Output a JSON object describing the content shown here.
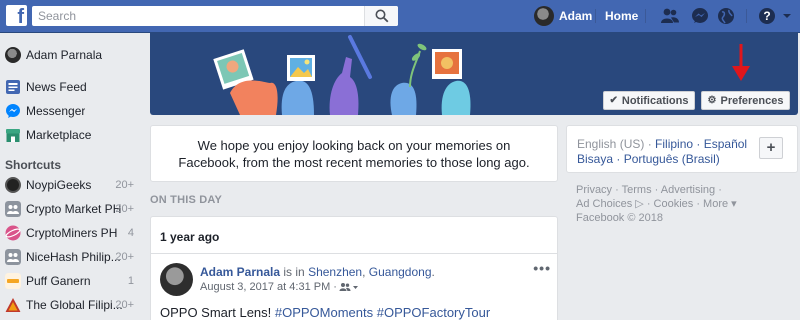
{
  "topbar": {
    "search_placeholder": "Search",
    "user_name": "Adam",
    "home_label": "Home"
  },
  "sidebar": {
    "user": {
      "label": "Adam Parnala"
    },
    "items": [
      {
        "label": "News Feed",
        "icon": "news-feed-icon"
      },
      {
        "label": "Messenger",
        "icon": "messenger-icon"
      },
      {
        "label": "Marketplace",
        "icon": "marketplace-icon"
      }
    ],
    "shortcuts_header": "Shortcuts",
    "shortcuts": [
      {
        "label": "NoypiGeeks",
        "count": "20+"
      },
      {
        "label": "Crypto Market PH",
        "count": "20+"
      },
      {
        "label": "CryptoMiners PH",
        "count": "4"
      },
      {
        "label": "NiceHash Philip...",
        "count": "20+"
      },
      {
        "label": "Puff Ganern",
        "count": "1"
      },
      {
        "label": "The Global Filipi...",
        "count": "20+"
      }
    ]
  },
  "banner": {
    "notifications_label": "Notifications",
    "preferences_label": "Preferences"
  },
  "intro": {
    "text": "We hope you enjoy looking back on your memories on Facebook, from the most recent memories to those long ago."
  },
  "section_label": "ON THIS DAY",
  "memory": {
    "period_label": "1 year ago",
    "post": {
      "author": "Adam Parnala",
      "is_in": " is in ",
      "city": "Shenzhen",
      "comma": ", ",
      "region": "Guangdong",
      "period": ".",
      "date": "August 3, 2017 at 4:31 PM · ",
      "text_plain": "OPPO Smart Lens! ",
      "tag1": "#OPPOMoments",
      "tag2": " #OPPOFactoryTour"
    }
  },
  "language": {
    "current": "English (US) · ",
    "links": [
      "Filipino",
      " · Español",
      "Bisaya",
      " · Português (Brasil)"
    ],
    "add_label": "+"
  },
  "footer": {
    "line1": "Privacy · Terms · Advertising ·",
    "line2": "Ad Choices ▷ · Cookies · More ▾",
    "line3": "Facebook © 2018"
  },
  "colors": {
    "brand": "#4267b2",
    "banner": "#29487d",
    "link": "#365899",
    "arrow": "#e0161b"
  }
}
